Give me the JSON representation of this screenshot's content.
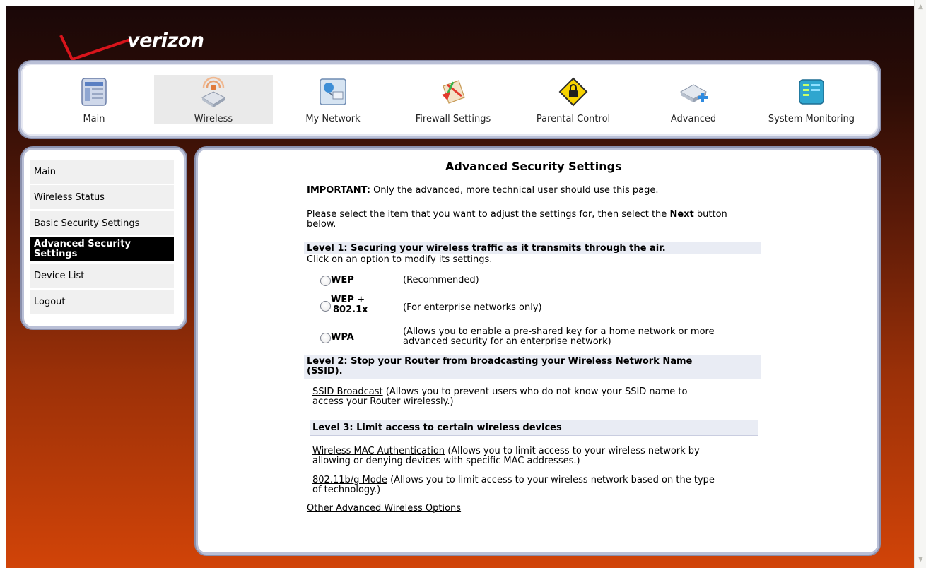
{
  "header": {
    "logo_text": "verizon"
  },
  "topnav": [
    {
      "label": "Main",
      "icon": "main-icon"
    },
    {
      "label": "Wireless",
      "icon": "wireless-icon",
      "active": true
    },
    {
      "label": "My Network",
      "icon": "my-network-icon"
    },
    {
      "label": "Firewall Settings",
      "icon": "firewall-icon"
    },
    {
      "label": "Parental Control",
      "icon": "parental-control-icon"
    },
    {
      "label": "Advanced",
      "icon": "advanced-icon"
    },
    {
      "label": "System Monitoring",
      "icon": "system-monitoring-icon"
    }
  ],
  "sidebar": {
    "items": [
      {
        "label": "Main"
      },
      {
        "label": "Wireless Status"
      },
      {
        "label": "Basic Security Settings"
      },
      {
        "label": "Advanced Security Settings",
        "active": true
      },
      {
        "label": "Device List"
      },
      {
        "label": "Logout"
      }
    ]
  },
  "content": {
    "title": "Advanced Security Settings",
    "important_label": "IMPORTANT:",
    "important_text": "Only the advanced, more technical user should use this page.",
    "intro_pre": "Please select the item that you want to adjust the settings for, then select the",
    "intro_bold": "Next",
    "intro_post": "button",
    "intro_line2": "below.",
    "level1": {
      "heading": "Level 1: Securing your wireless traffic as it transmits through the air.",
      "sub": "Click on an option to modify its settings.",
      "options": [
        {
          "label": "WEP",
          "desc": "(Recommended)"
        },
        {
          "label_line1": "WEP +",
          "label_line2": "802.1x",
          "desc": "(For enterprise networks only)"
        },
        {
          "label": "WPA",
          "desc_line1": "(Allows you to enable a pre-shared key for a home network or more",
          "desc_line2": "advanced security for an enterprise network)"
        }
      ]
    },
    "level2": {
      "heading_line1": "Level 2: Stop your Router from broadcasting your Wireless Network Name",
      "heading_line2": "(SSID).",
      "link": "SSID Broadcast",
      "desc_line1": "(Allows you to prevent users who do not know your SSID name to",
      "desc_line2": "access your Router wirelessly.)"
    },
    "level3": {
      "heading": "Level 3: Limit access to certain wireless devices",
      "items": [
        {
          "link": "Wireless MAC Authentication",
          "desc_line1": "(Allows you to limit access to your wireless network by",
          "desc_line2": "allowing or denying devices with specific MAC addresses.)"
        },
        {
          "link": "802.11b/g Mode",
          "desc_line1": "(Allows you to limit access to your wireless network based on the type",
          "desc_line2": "of technology.)"
        }
      ]
    },
    "other_link": "Other Advanced Wireless Options"
  }
}
